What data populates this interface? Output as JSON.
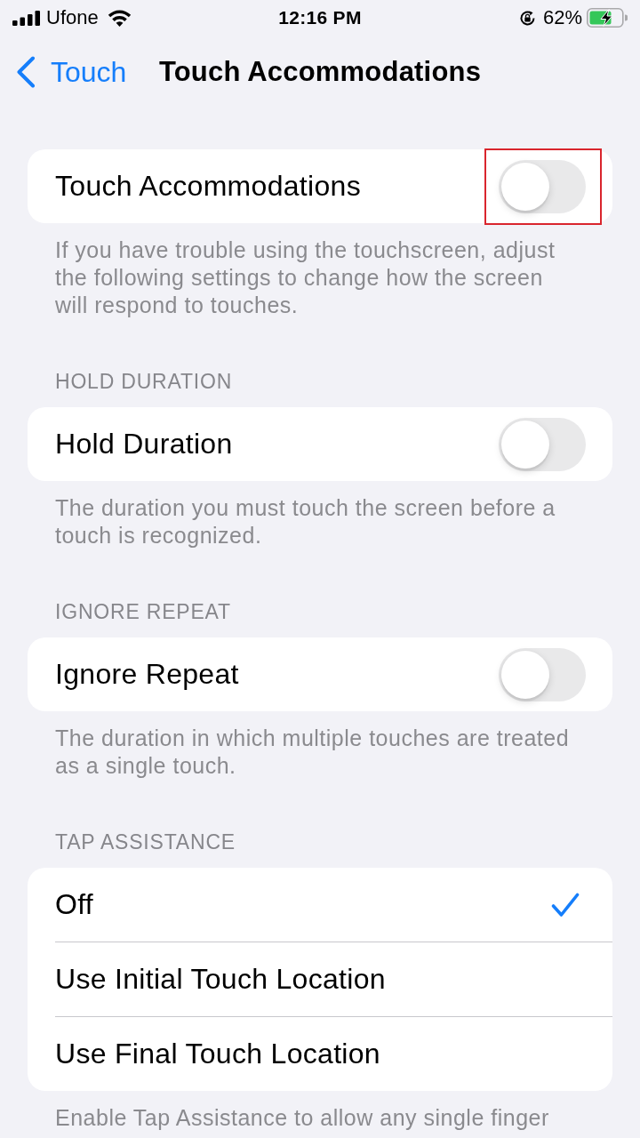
{
  "status_bar": {
    "carrier": "Ufone",
    "time": "12:16 PM",
    "orientation_lock": true,
    "battery": "62%",
    "charging": true
  },
  "nav_bar": {
    "back_label": "Touch",
    "title": "Touch Accommodations"
  },
  "sections": [
    {
      "rows": [
        {
          "kind": "toggle",
          "label": "Touch Accommodations",
          "on": false,
          "highlighted": true
        }
      ],
      "footer": "If you have trouble using the touchscreen, adjust the following settings to change how the screen will respond to touches."
    },
    {
      "header": "HOLD DURATION",
      "rows": [
        {
          "kind": "toggle",
          "label": "Hold Duration",
          "on": false,
          "highlighted": false
        }
      ],
      "footer": "The duration you must touch the screen before a touch is recognized."
    },
    {
      "header": "IGNORE REPEAT",
      "rows": [
        {
          "kind": "toggle",
          "label": "Ignore Repeat",
          "on": false,
          "highlighted": false
        }
      ],
      "footer": "The duration in which multiple touches are treated as a single touch."
    },
    {
      "header": "TAP ASSISTANCE",
      "rows": [
        {
          "kind": "option",
          "label": "Off",
          "selected": true
        },
        {
          "kind": "option",
          "label": "Use Initial Touch Location",
          "selected": false
        },
        {
          "kind": "option",
          "label": "Use Final Touch Location",
          "selected": false
        }
      ],
      "footer": "Enable Tap Assistance to allow any single finger"
    }
  ]
}
